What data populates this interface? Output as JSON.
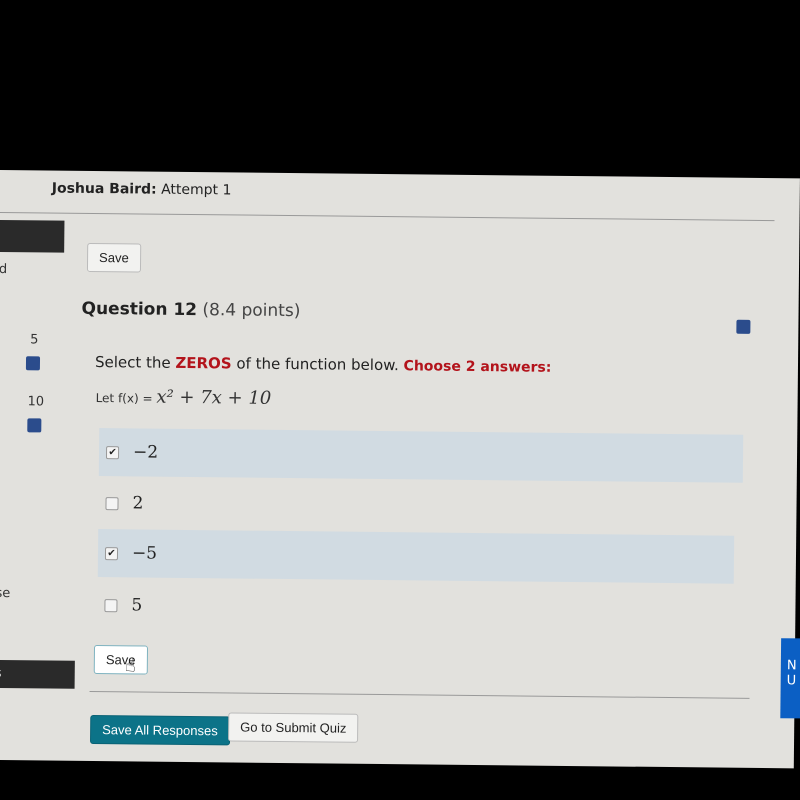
{
  "header": {
    "name": "Joshua Baird:",
    "attempt": "Attempt 1"
  },
  "toolbar": {
    "save_label": "Save"
  },
  "question": {
    "title": "Question 12",
    "points": "(8.4 points)",
    "prompt_pre": "Select the ",
    "prompt_keyword": "ZEROS",
    "prompt_post": " of the function below. ",
    "prompt_instruction": "Choose 2 answers:",
    "function_label": "Let f(x) = ",
    "function_expr": "x² + 7x + 10"
  },
  "options": [
    {
      "label": "−2",
      "checked": true
    },
    {
      "label": "2",
      "checked": false
    },
    {
      "label": "−5",
      "checked": true
    },
    {
      "label": "5",
      "checked": false
    }
  ],
  "question_save_label": "Save",
  "sidebar": {
    "partial_1": "d",
    "num_1": "5",
    "num_2": "10",
    "partial_2": "se",
    "partial_3": "s"
  },
  "footer": {
    "save_all": "Save All Responses",
    "submit": "Go to Submit Quiz"
  },
  "right_panel": {
    "partial_1": "N",
    "partial_2": "U"
  },
  "colors": {
    "accent_red": "#b3131b",
    "primary_button": "#0c7388",
    "selected_row": "#d1dbe2",
    "save_icon": "#2b4c8c"
  },
  "icons": [
    "save-disk-icon",
    "hand-cursor-icon"
  ]
}
